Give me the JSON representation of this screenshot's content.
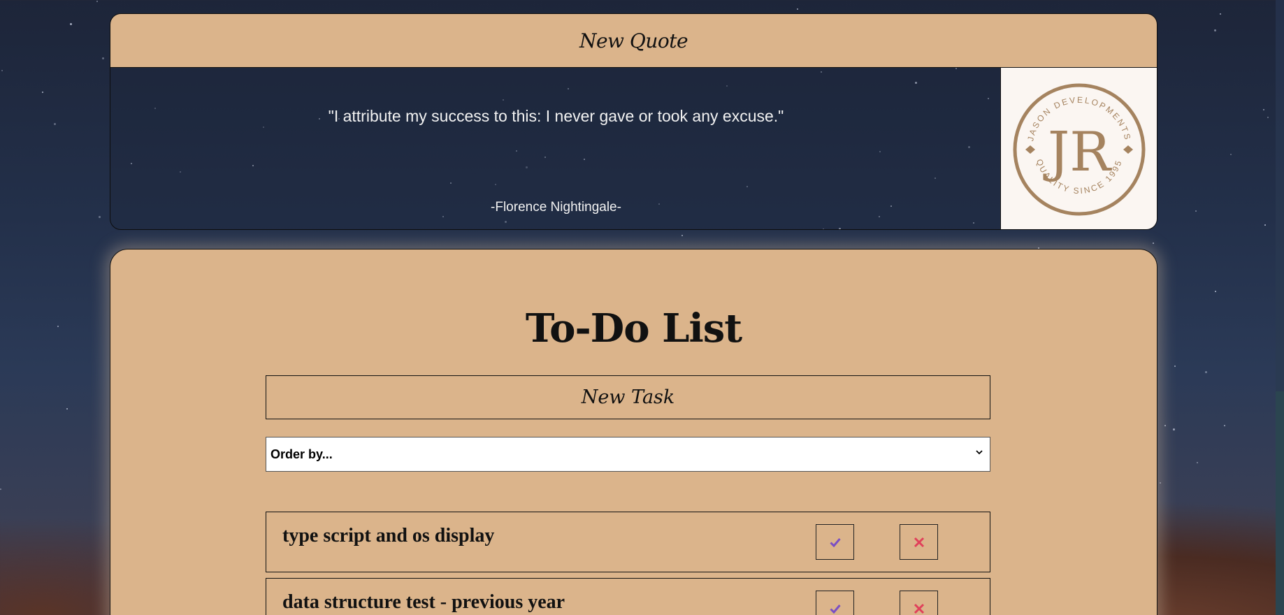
{
  "quote": {
    "header_label": "New Quote",
    "text": "\"I attribute my success to this: I never gave or took any excuse.\"",
    "author": "-Florence Nightingale-"
  },
  "logo": {
    "monogram": "JR",
    "ring_top": "JASON DEVELOPMENTS",
    "ring_bottom": "QUALITY SINCE 1995",
    "color": "#a5835f"
  },
  "todo": {
    "title": "To-Do List",
    "new_task_label": "New Task",
    "order_select": {
      "selected": "Order by..."
    },
    "tasks": [
      {
        "text": "type script and os display"
      },
      {
        "text": "data structure test - previous year"
      }
    ]
  },
  "colors": {
    "card_bg": "#dbb48b",
    "check_icon": "#7a4fc4",
    "delete_icon": "#e0405a"
  },
  "icons": {
    "check": "check-icon",
    "delete": "close-icon",
    "select_arrow": "chevron-down-icon"
  }
}
